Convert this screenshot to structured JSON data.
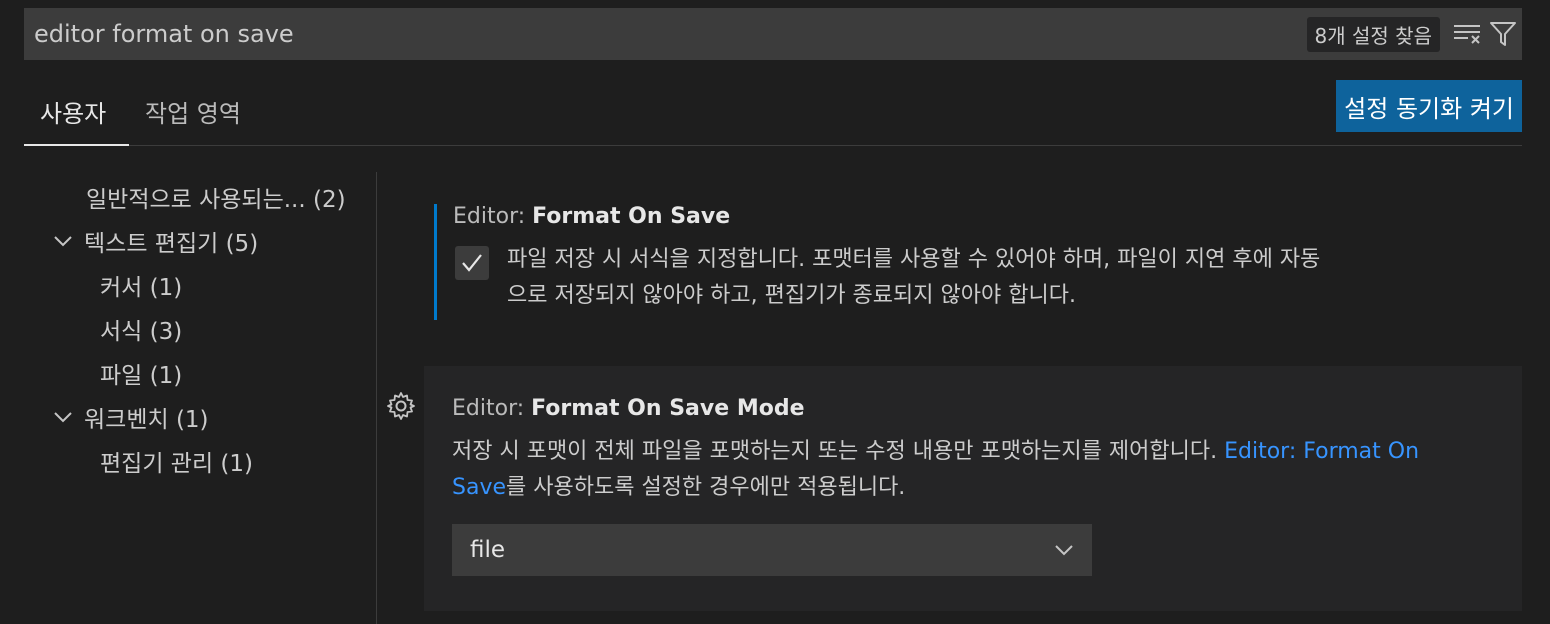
{
  "search": {
    "value": "editor format on save",
    "result_count": "8개 설정 찾음",
    "clear_icon": "clear-filter-icon",
    "filter_icon": "filter-icon"
  },
  "tabs": [
    {
      "label": "사용자"
    },
    {
      "label": "작업 영역"
    }
  ],
  "sync_button_label": "설정 동기화 켜기",
  "toc": {
    "items": [
      {
        "label": "일반적으로 사용되는... (2)"
      },
      {
        "label": "텍스트 편집기 (5)"
      },
      {
        "label": "커서 (1)"
      },
      {
        "label": "서식 (3)"
      },
      {
        "label": "파일 (1)"
      },
      {
        "label": "워크벤치 (1)"
      },
      {
        "label": "편집기 관리 (1)"
      }
    ]
  },
  "settings": [
    {
      "category": "Editor: ",
      "name": "Format On Save",
      "checked": true,
      "description_line1": "파일 저장 시 서식을 지정합니다. 포맷터를 사용할 수 있어야 하며, 파일이 지연 후에 자동",
      "description_line2": "으로 저장되지 않아야 하고, 편집기가 종료되지 않아야 합니다."
    },
    {
      "category": "Editor: ",
      "name": "Format On Save Mode",
      "description_before": "저장 시 포맷이 전체 파일을 포맷하는지 또는 수정 내용만 포맷하는지를 제어합니다. ",
      "link_part1": "Editor:",
      "link_part2": "Format On Save",
      "description_after": "를 사용하도록 설정한 경우에만 적용됩니다.",
      "selected_value": "file"
    }
  ],
  "colors": {
    "accent": "#007acc",
    "button": "#0e639c",
    "link": "#3794ff"
  }
}
